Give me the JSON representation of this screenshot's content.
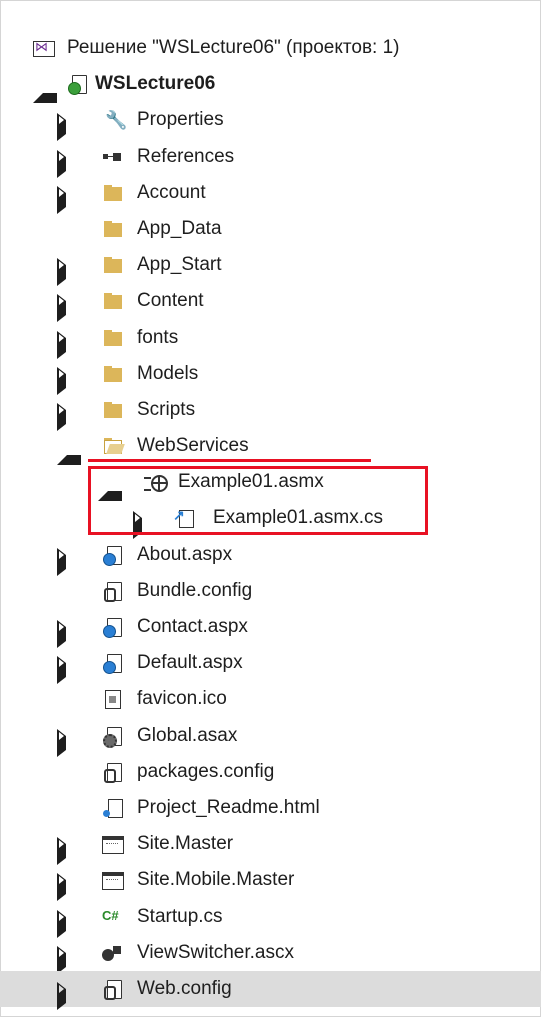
{
  "solution_explorer": {
    "items": [
      {
        "label": "Решение \"WSLecture06\"  (проектов: 1)",
        "icon": "solution-icon",
        "expander": "none",
        "depth": 0,
        "bold": false,
        "selected": false
      },
      {
        "label": "WSLecture06",
        "icon": "web-project-icon",
        "expander": "expanded",
        "depth": 0,
        "bold": true,
        "selected": false
      },
      {
        "label": "Properties",
        "icon": "wrench-icon",
        "expander": "collapsed",
        "depth": 1,
        "bold": false,
        "selected": false
      },
      {
        "label": "References",
        "icon": "references-icon",
        "expander": "collapsed",
        "depth": 1,
        "bold": false,
        "selected": false
      },
      {
        "label": "Account",
        "icon": "folder-icon",
        "expander": "collapsed",
        "depth": 1,
        "bold": false,
        "selected": false
      },
      {
        "label": "App_Data",
        "icon": "folder-icon",
        "expander": "none",
        "depth": 1,
        "bold": false,
        "selected": false
      },
      {
        "label": "App_Start",
        "icon": "folder-icon",
        "expander": "collapsed",
        "depth": 1,
        "bold": false,
        "selected": false
      },
      {
        "label": "Content",
        "icon": "folder-icon",
        "expander": "collapsed",
        "depth": 1,
        "bold": false,
        "selected": false
      },
      {
        "label": "fonts",
        "icon": "folder-icon",
        "expander": "collapsed",
        "depth": 1,
        "bold": false,
        "selected": false
      },
      {
        "label": "Models",
        "icon": "folder-icon",
        "expander": "collapsed",
        "depth": 1,
        "bold": false,
        "selected": false
      },
      {
        "label": "Scripts",
        "icon": "folder-icon",
        "expander": "collapsed",
        "depth": 1,
        "bold": false,
        "selected": false
      },
      {
        "label": "WebServices",
        "icon": "folder-open-icon",
        "expander": "expanded",
        "depth": 1,
        "bold": false,
        "selected": false
      },
      {
        "label": "Example01.asmx",
        "icon": "web-service-icon",
        "expander": "expanded",
        "depth": 2,
        "bold": false,
        "selected": false
      },
      {
        "label": "Example01.asmx.cs",
        "icon": "csharp-file-icon",
        "expander": "collapsed",
        "depth": 3,
        "bold": false,
        "selected": false
      },
      {
        "label": "About.aspx",
        "icon": "aspx-page-icon",
        "expander": "collapsed",
        "depth": 1,
        "bold": false,
        "selected": false
      },
      {
        "label": "Bundle.config",
        "icon": "config-file-icon",
        "expander": "none",
        "depth": 1,
        "bold": false,
        "selected": false
      },
      {
        "label": "Contact.aspx",
        "icon": "aspx-page-icon",
        "expander": "collapsed",
        "depth": 1,
        "bold": false,
        "selected": false
      },
      {
        "label": "Default.aspx",
        "icon": "aspx-page-icon",
        "expander": "collapsed",
        "depth": 1,
        "bold": false,
        "selected": false
      },
      {
        "label": "favicon.ico",
        "icon": "icon-file-icon",
        "expander": "none",
        "depth": 1,
        "bold": false,
        "selected": false
      },
      {
        "label": "Global.asax",
        "icon": "global-asax-icon",
        "expander": "collapsed",
        "depth": 1,
        "bold": false,
        "selected": false
      },
      {
        "label": "packages.config",
        "icon": "config-file-icon",
        "expander": "none",
        "depth": 1,
        "bold": false,
        "selected": false
      },
      {
        "label": "Project_Readme.html",
        "icon": "html-file-icon",
        "expander": "none",
        "depth": 1,
        "bold": false,
        "selected": false
      },
      {
        "label": "Site.Master",
        "icon": "master-page-icon",
        "expander": "collapsed",
        "depth": 1,
        "bold": false,
        "selected": false
      },
      {
        "label": "Site.Mobile.Master",
        "icon": "master-page-icon",
        "expander": "collapsed",
        "depth": 1,
        "bold": false,
        "selected": false
      },
      {
        "label": "Startup.cs",
        "icon": "csharp-icon",
        "expander": "collapsed",
        "depth": 1,
        "bold": false,
        "selected": false
      },
      {
        "label": "ViewSwitcher.ascx",
        "icon": "user-control-icon",
        "expander": "collapsed",
        "depth": 1,
        "bold": false,
        "selected": false
      },
      {
        "label": "Web.config",
        "icon": "config-file-icon",
        "expander": "collapsed",
        "depth": 1,
        "bold": false,
        "selected": true
      }
    ]
  },
  "annotations": {
    "highlight_color": "#e81123"
  },
  "colors": {
    "selected_row": "#dcdcdc",
    "folder": "#dcb65a"
  }
}
